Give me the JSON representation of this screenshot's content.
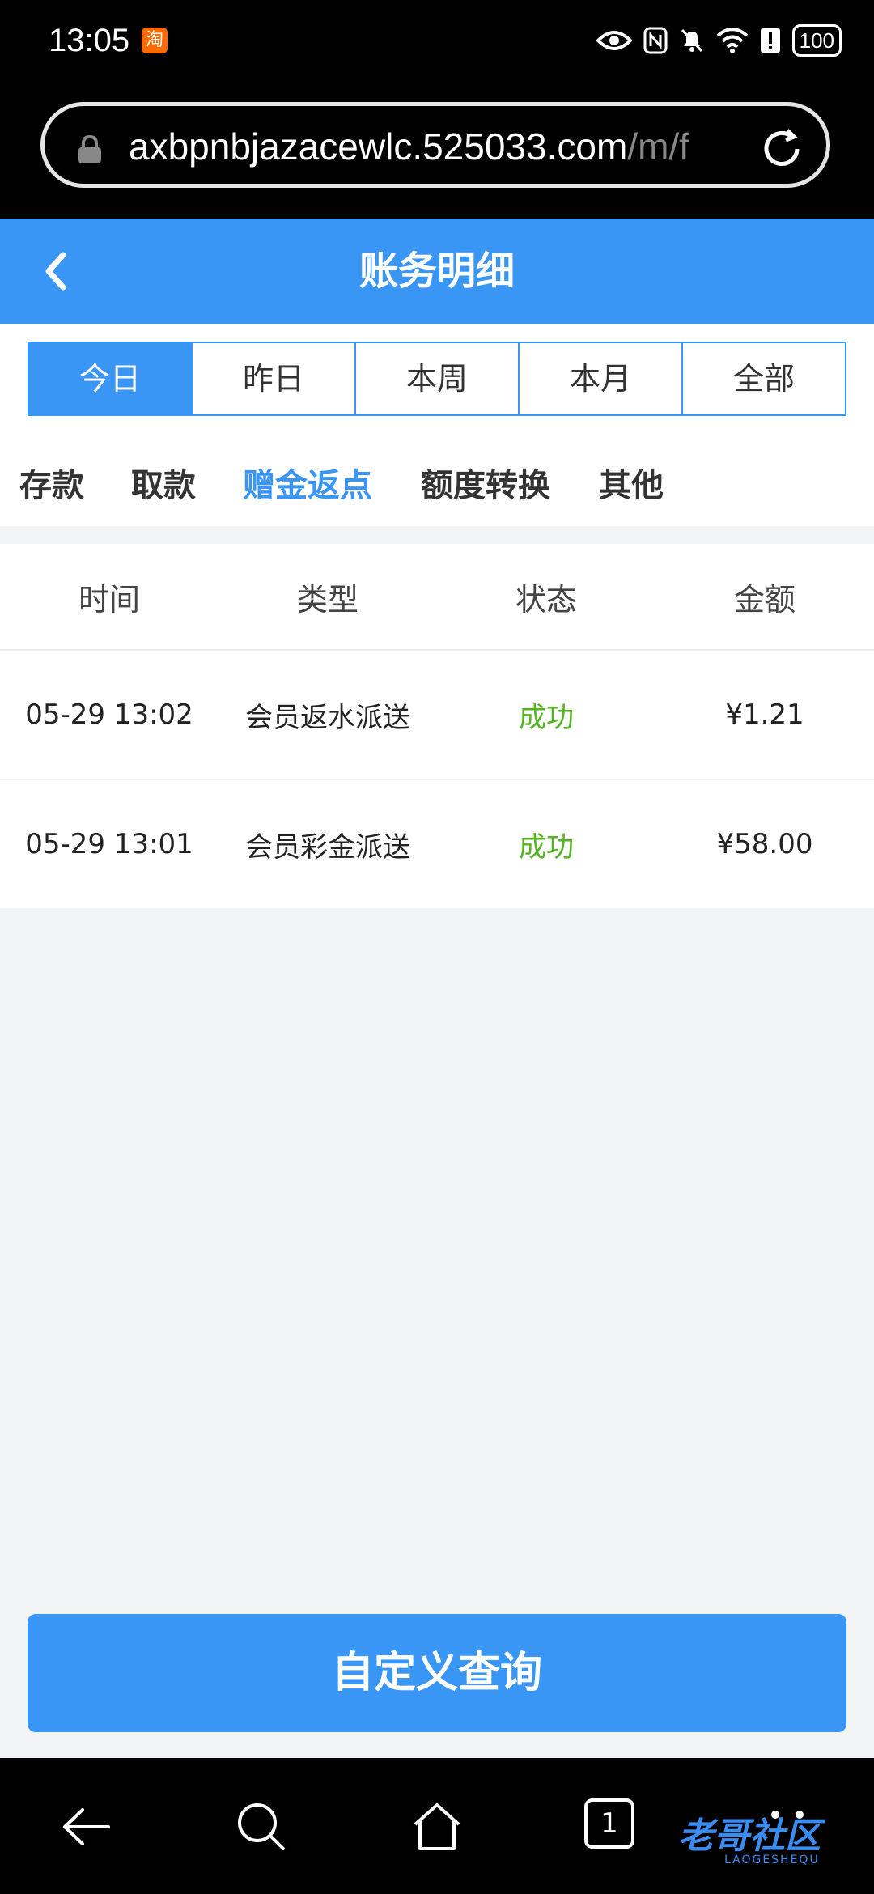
{
  "status_bar": {
    "time": "13:05",
    "app_badge": "淘",
    "battery": "100",
    "icons": [
      "eye-icon",
      "nfc-icon",
      "mute-icon",
      "wifi-icon",
      "alert-icon",
      "battery-icon"
    ]
  },
  "browser": {
    "url_main": "axbpnbjazacewlc.525033.com",
    "url_tail": "/m/f"
  },
  "header": {
    "title": "账务明细"
  },
  "date_tabs": [
    {
      "label": "今日",
      "active": true
    },
    {
      "label": "昨日",
      "active": false
    },
    {
      "label": "本周",
      "active": false
    },
    {
      "label": "本月",
      "active": false
    },
    {
      "label": "全部",
      "active": false
    }
  ],
  "category_tabs": [
    {
      "label": "存款",
      "active": false
    },
    {
      "label": "取款",
      "active": false
    },
    {
      "label": "赠金返点",
      "active": true
    },
    {
      "label": "额度转换",
      "active": false
    },
    {
      "label": "其他",
      "active": false
    }
  ],
  "table": {
    "columns": [
      "时间",
      "类型",
      "状态",
      "金额"
    ],
    "rows": [
      {
        "time": "05-29 13:02",
        "type": "会员返水派送",
        "status": "成功",
        "amount": "¥1.21"
      },
      {
        "time": "05-29 13:01",
        "type": "会员彩金派送",
        "status": "成功",
        "amount": "¥58.00"
      }
    ]
  },
  "query_button": "自定义查询",
  "nav": {
    "tab_count": "1",
    "watermark": "老哥社区",
    "watermark_sub": "LAOGESHEQU"
  },
  "colors": {
    "accent": "#3a96f5",
    "success": "#52b520",
    "background": "#f3f4f6"
  }
}
